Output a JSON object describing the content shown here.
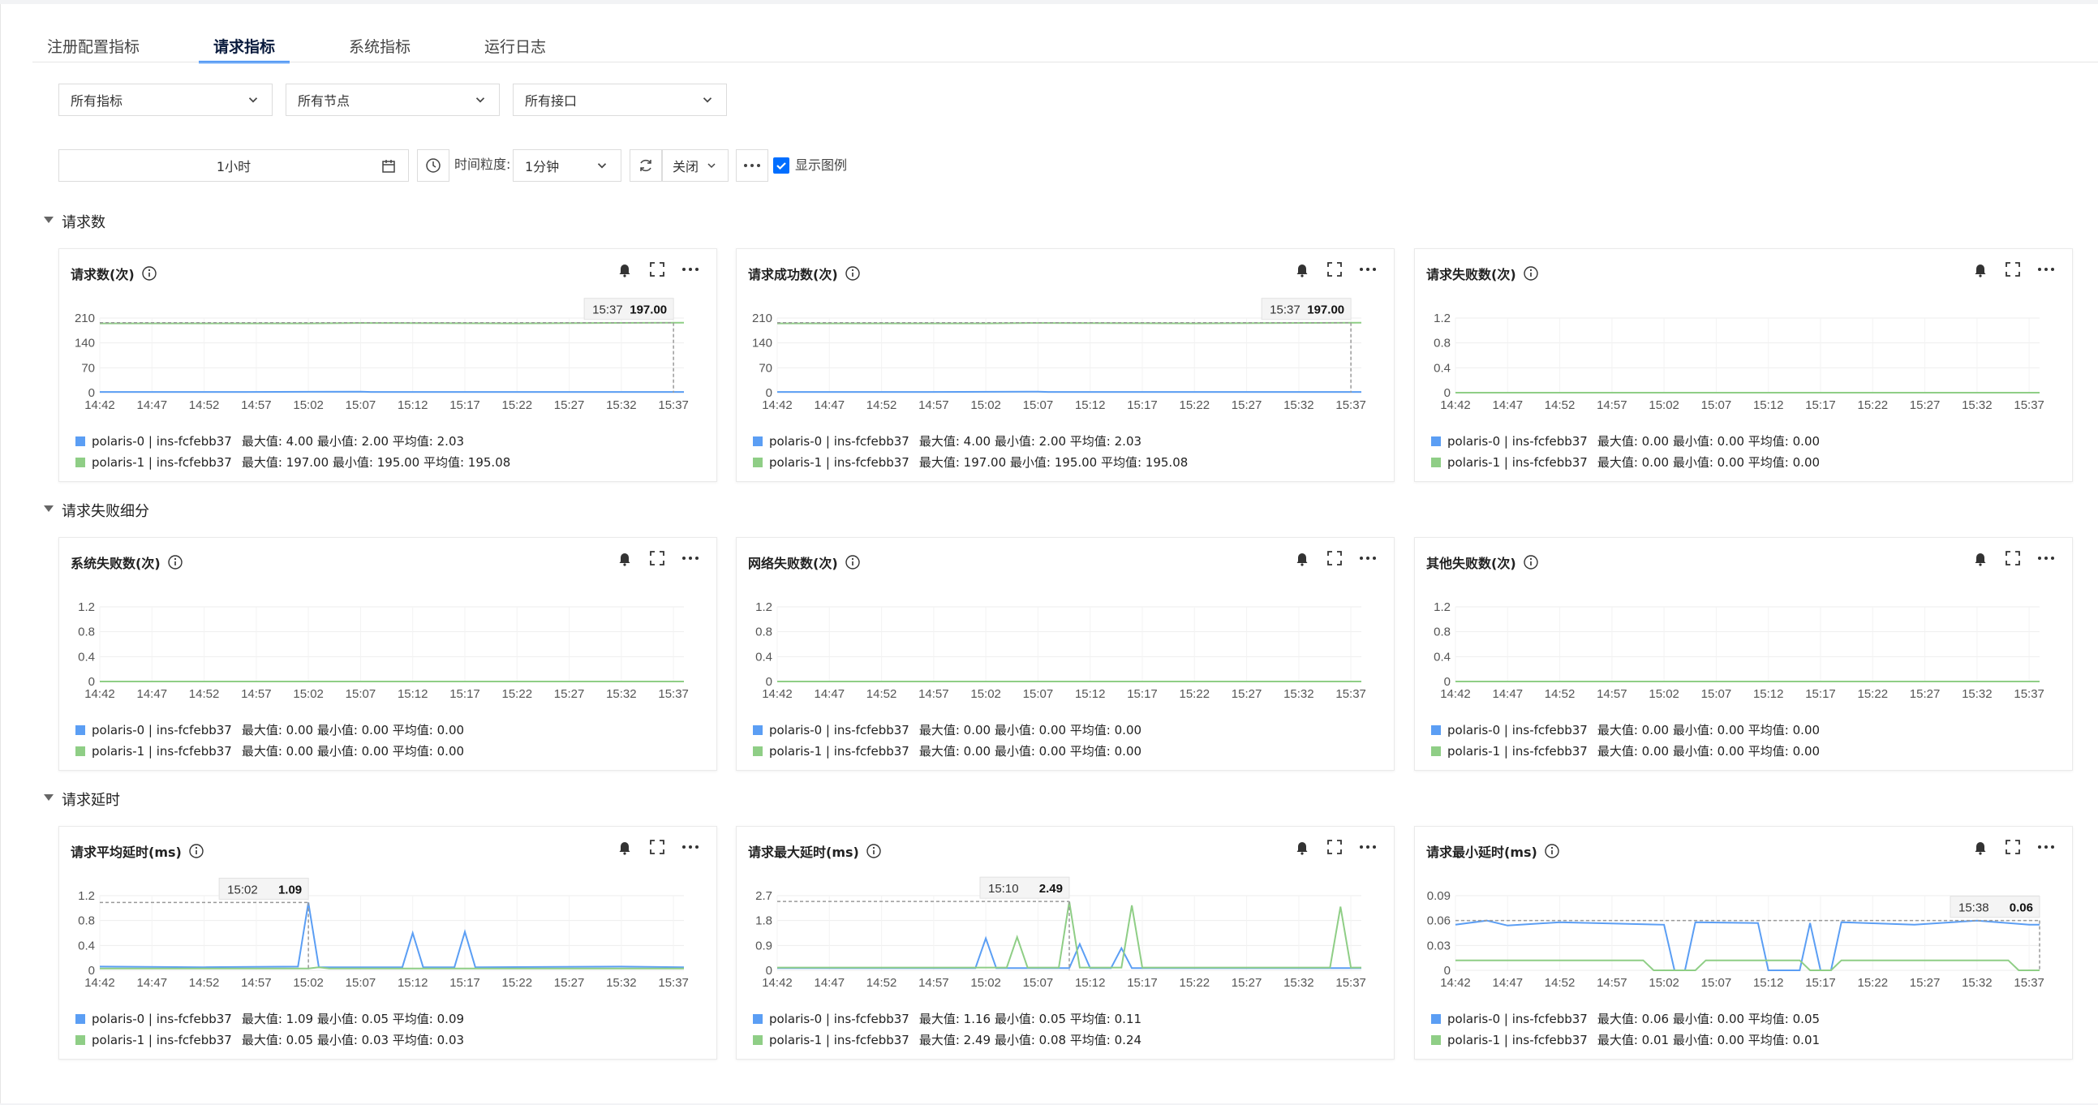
{
  "tabs": [
    {
      "label": "注册配置指标"
    },
    {
      "label": "请求指标"
    },
    {
      "label": "系统指标"
    },
    {
      "label": "运行日志"
    }
  ],
  "filters": {
    "metric": "所有指标",
    "node": "所有节点",
    "api": "所有接口"
  },
  "toolbar": {
    "time_range": "1小时",
    "granularity_label": "时间粒度:",
    "granularity": "1分钟",
    "auto_refresh": "关闭",
    "show_legend": "显示图例"
  },
  "colors": {
    "series0": "#5b9ef4",
    "series1": "#8fce86",
    "accent": "#006eff"
  },
  "x_ticks": [
    "14:42",
    "14:47",
    "14:52",
    "14:57",
    "15:02",
    "15:07",
    "15:12",
    "15:17",
    "15:22",
    "15:27",
    "15:32",
    "15:37"
  ],
  "sections": [
    {
      "title": "请求数"
    },
    {
      "title": "请求失败细分"
    },
    {
      "title": "请求延时"
    }
  ],
  "charts": [
    {
      "title": "请求数(次)",
      "yticks": [
        "210",
        "140",
        "70",
        "0"
      ],
      "ymax": 210,
      "tooltip_time": "15:37",
      "tooltip_value": "197.00",
      "legend": [
        {
          "name": "polaris-0 | ins-fcfebb37",
          "stats": "最大值: 4.00  最小值: 2.00  平均值: 2.03"
        },
        {
          "name": "polaris-1 | ins-fcfebb37",
          "stats": "最大值: 197.00  最小值: 195.00  平均值: 195.08"
        }
      ]
    },
    {
      "title": "请求成功数(次)",
      "yticks": [
        "210",
        "140",
        "70",
        "0"
      ],
      "ymax": 210,
      "tooltip_time": "15:37",
      "tooltip_value": "197.00",
      "legend": [
        {
          "name": "polaris-0 | ins-fcfebb37",
          "stats": "最大值: 4.00  最小值: 2.00  平均值: 2.03"
        },
        {
          "name": "polaris-1 | ins-fcfebb37",
          "stats": "最大值: 197.00  最小值: 195.00  平均值: 195.08"
        }
      ]
    },
    {
      "title": "请求失败数(次)",
      "yticks": [
        "1.2",
        "0.8",
        "0.4",
        "0"
      ],
      "ymax": 1.2,
      "legend": [
        {
          "name": "polaris-0 | ins-fcfebb37",
          "stats": "最大值: 0.00  最小值: 0.00  平均值: 0.00"
        },
        {
          "name": "polaris-1 | ins-fcfebb37",
          "stats": "最大值: 0.00  最小值: 0.00  平均值: 0.00"
        }
      ]
    },
    {
      "title": "系统失败数(次)",
      "yticks": [
        "1.2",
        "0.8",
        "0.4",
        "0"
      ],
      "ymax": 1.2,
      "legend": [
        {
          "name": "polaris-0 | ins-fcfebb37",
          "stats": "最大值: 0.00  最小值: 0.00  平均值: 0.00"
        },
        {
          "name": "polaris-1 | ins-fcfebb37",
          "stats": "最大值: 0.00  最小值: 0.00  平均值: 0.00"
        }
      ]
    },
    {
      "title": "网络失败数(次)",
      "yticks": [
        "1.2",
        "0.8",
        "0.4",
        "0"
      ],
      "ymax": 1.2,
      "legend": [
        {
          "name": "polaris-0 | ins-fcfebb37",
          "stats": "最大值: 0.00  最小值: 0.00  平均值: 0.00"
        },
        {
          "name": "polaris-1 | ins-fcfebb37",
          "stats": "最大值: 0.00  最小值: 0.00  平均值: 0.00"
        }
      ]
    },
    {
      "title": "其他失败数(次)",
      "yticks": [
        "1.2",
        "0.8",
        "0.4",
        "0"
      ],
      "ymax": 1.2,
      "legend": [
        {
          "name": "polaris-0 | ins-fcfebb37",
          "stats": "最大值: 0.00  最小值: 0.00  平均值: 0.00"
        },
        {
          "name": "polaris-1 | ins-fcfebb37",
          "stats": "最大值: 0.00  最小值: 0.00  平均值: 0.00"
        }
      ]
    },
    {
      "title": "请求平均延时(ms)",
      "yticks": [
        "1.2",
        "0.8",
        "0.4",
        "0"
      ],
      "ymax": 1.2,
      "tooltip_time": "15:02",
      "tooltip_value": "1.09",
      "legend": [
        {
          "name": "polaris-0 | ins-fcfebb37",
          "stats": "最大值: 1.09  最小值: 0.05  平均值: 0.09"
        },
        {
          "name": "polaris-1 | ins-fcfebb37",
          "stats": "最大值: 0.05  最小值: 0.03  平均值: 0.03"
        }
      ]
    },
    {
      "title": "请求最大延时(ms)",
      "yticks": [
        "2.7",
        "1.8",
        "0.9",
        "0"
      ],
      "ymax": 2.7,
      "tooltip_time": "15:10",
      "tooltip_value": "2.49",
      "legend": [
        {
          "name": "polaris-0 | ins-fcfebb37",
          "stats": "最大值: 1.16  最小值: 0.05  平均值: 0.11"
        },
        {
          "name": "polaris-1 | ins-fcfebb37",
          "stats": "最大值: 2.49  最小值: 0.08  平均值: 0.24"
        }
      ]
    },
    {
      "title": "请求最小延时(ms)",
      "yticks": [
        "0.09",
        "0.06",
        "0.03",
        "0"
      ],
      "ymax": 0.09,
      "tooltip_time": "15:38",
      "tooltip_value": "0.06",
      "legend": [
        {
          "name": "polaris-0 | ins-fcfebb37",
          "stats": "最大值: 0.06  最小值: 0.00  平均值: 0.05"
        },
        {
          "name": "polaris-1 | ins-fcfebb37",
          "stats": "最大值: 0.01  最小值: 0.00  平均值: 0.01"
        }
      ]
    }
  ],
  "chart_data": [
    {
      "type": "line",
      "title": "请求数(次)",
      "ylim": [
        0,
        210
      ],
      "x_range": [
        "14:42",
        "15:38"
      ],
      "series": [
        {
          "name": "polaris-0 | ins-fcfebb37",
          "points": [
            [
              0,
              2
            ],
            [
              14,
              2
            ],
            [
              25,
              3
            ],
            [
              26,
              2
            ],
            [
              56,
              2
            ]
          ]
        },
        {
          "name": "polaris-1 | ins-fcfebb37",
          "points": [
            [
              0,
              195
            ],
            [
              20,
              195
            ],
            [
              25,
              196
            ],
            [
              40,
              195
            ],
            [
              56,
              197
            ]
          ]
        }
      ]
    },
    {
      "type": "line",
      "title": "请求成功数(次)",
      "ylim": [
        0,
        210
      ],
      "x_range": [
        "14:42",
        "15:38"
      ],
      "series": [
        {
          "name": "polaris-0 | ins-fcfebb37",
          "points": [
            [
              0,
              2
            ],
            [
              14,
              2
            ],
            [
              25,
              3
            ],
            [
              26,
              2
            ],
            [
              56,
              2
            ]
          ]
        },
        {
          "name": "polaris-1 | ins-fcfebb37",
          "points": [
            [
              0,
              195
            ],
            [
              20,
              195
            ],
            [
              25,
              196
            ],
            [
              40,
              195
            ],
            [
              56,
              197
            ]
          ]
        }
      ]
    },
    {
      "type": "line",
      "title": "请求失败数(次)",
      "ylim": [
        0,
        1.2
      ],
      "x_range": [
        "14:42",
        "15:38"
      ],
      "series": [
        {
          "name": "polaris-0 | ins-fcfebb37",
          "points": [
            [
              0,
              0
            ],
            [
              56,
              0
            ]
          ]
        },
        {
          "name": "polaris-1 | ins-fcfebb37",
          "points": [
            [
              0,
              0
            ],
            [
              56,
              0
            ]
          ]
        }
      ]
    },
    {
      "type": "line",
      "title": "系统失败数(次)",
      "ylim": [
        0,
        1.2
      ],
      "x_range": [
        "14:42",
        "15:38"
      ],
      "series": [
        {
          "name": "polaris-0 | ins-fcfebb37",
          "points": [
            [
              0,
              0
            ],
            [
              56,
              0
            ]
          ]
        },
        {
          "name": "polaris-1 | ins-fcfebb37",
          "points": [
            [
              0,
              0
            ],
            [
              56,
              0
            ]
          ]
        }
      ]
    },
    {
      "type": "line",
      "title": "网络失败数(次)",
      "ylim": [
        0,
        1.2
      ],
      "x_range": [
        "14:42",
        "15:38"
      ],
      "series": [
        {
          "name": "polaris-0 | ins-fcfebb37",
          "points": [
            [
              0,
              0
            ],
            [
              56,
              0
            ]
          ]
        },
        {
          "name": "polaris-1 | ins-fcfebb37",
          "points": [
            [
              0,
              0
            ],
            [
              56,
              0
            ]
          ]
        }
      ]
    },
    {
      "type": "line",
      "title": "其他失败数(次)",
      "ylim": [
        0,
        1.2
      ],
      "x_range": [
        "14:42",
        "15:38"
      ],
      "series": [
        {
          "name": "polaris-0 | ins-fcfebb37",
          "points": [
            [
              0,
              0
            ],
            [
              56,
              0
            ]
          ]
        },
        {
          "name": "polaris-1 | ins-fcfebb37",
          "points": [
            [
              0,
              0
            ],
            [
              56,
              0
            ]
          ]
        }
      ]
    },
    {
      "type": "line",
      "title": "请求平均延时(ms)",
      "ylim": [
        0,
        1.2
      ],
      "x_range": [
        "14:42",
        "15:38"
      ],
      "series": [
        {
          "name": "polaris-0 | ins-fcfebb37",
          "points": [
            [
              0,
              0.06
            ],
            [
              10,
              0.05
            ],
            [
              19,
              0.06
            ],
            [
              20,
              1.09
            ],
            [
              21,
              0.05
            ],
            [
              29,
              0.05
            ],
            [
              30,
              0.6
            ],
            [
              31,
              0.05
            ],
            [
              34,
              0.05
            ],
            [
              35,
              0.62
            ],
            [
              36,
              0.05
            ],
            [
              50,
              0.06
            ],
            [
              56,
              0.05
            ]
          ]
        },
        {
          "name": "polaris-1 | ins-fcfebb37",
          "points": [
            [
              0,
              0.03
            ],
            [
              20,
              0.03
            ],
            [
              21,
              0.05
            ],
            [
              22,
              0.03
            ],
            [
              56,
              0.03
            ]
          ]
        }
      ]
    },
    {
      "type": "line",
      "title": "请求最大延时(ms)",
      "ylim": [
        0,
        2.7
      ],
      "x_range": [
        "14:42",
        "15:38"
      ],
      "series": [
        {
          "name": "polaris-0 | ins-fcfebb37",
          "points": [
            [
              0,
              0.08
            ],
            [
              19,
              0.08
            ],
            [
              20,
              1.16
            ],
            [
              21,
              0.08
            ],
            [
              28,
              0.08
            ],
            [
              29,
              0.95
            ],
            [
              30,
              0.08
            ],
            [
              32,
              0.08
            ],
            [
              33,
              0.8
            ],
            [
              34,
              0.08
            ],
            [
              56,
              0.08
            ]
          ]
        },
        {
          "name": "polaris-1 | ins-fcfebb37",
          "points": [
            [
              0,
              0.1
            ],
            [
              22,
              0.1
            ],
            [
              23,
              1.2
            ],
            [
              24,
              0.1
            ],
            [
              27,
              0.1
            ],
            [
              28,
              2.49
            ],
            [
              29,
              0.1
            ],
            [
              33,
              0.1
            ],
            [
              34,
              2.35
            ],
            [
              35,
              0.1
            ],
            [
              53,
              0.1
            ],
            [
              54,
              2.3
            ],
            [
              55,
              0.1
            ],
            [
              56,
              0.1
            ]
          ]
        }
      ]
    },
    {
      "type": "line",
      "title": "请求最小延时(ms)",
      "ylim": [
        0,
        0.09
      ],
      "x_range": [
        "14:42",
        "15:38"
      ],
      "series": [
        {
          "name": "polaris-0 | ins-fcfebb37",
          "points": [
            [
              0,
              0.055
            ],
            [
              3,
              0.06
            ],
            [
              5,
              0.054
            ],
            [
              10,
              0.058
            ],
            [
              20,
              0.055
            ],
            [
              21,
              0
            ],
            [
              22,
              0
            ],
            [
              23,
              0.058
            ],
            [
              29,
              0.057
            ],
            [
              30,
              0
            ],
            [
              33,
              0
            ],
            [
              34,
              0.057
            ],
            [
              35,
              0
            ],
            [
              36,
              0
            ],
            [
              37,
              0.058
            ],
            [
              44,
              0.055
            ],
            [
              50,
              0.06
            ],
            [
              55,
              0.055
            ],
            [
              56,
              0.055
            ]
          ]
        },
        {
          "name": "polaris-1 | ins-fcfebb37",
          "points": [
            [
              0,
              0.012
            ],
            [
              18,
              0.012
            ],
            [
              19,
              0
            ],
            [
              23,
              0
            ],
            [
              24,
              0.012
            ],
            [
              33,
              0.012
            ],
            [
              34,
              0
            ],
            [
              36,
              0
            ],
            [
              37,
              0.012
            ],
            [
              53,
              0.012
            ],
            [
              54,
              0
            ],
            [
              56,
              0
            ]
          ]
        }
      ]
    }
  ]
}
